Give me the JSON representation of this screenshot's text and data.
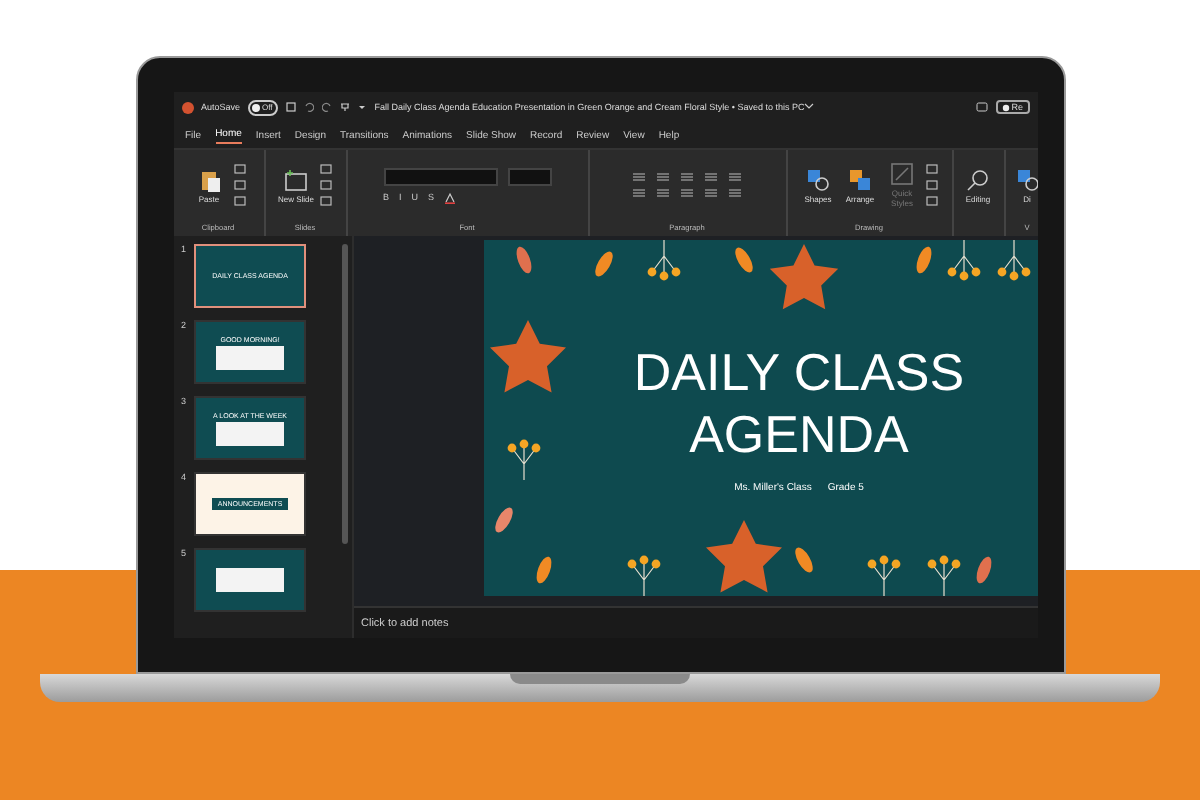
{
  "titlebar": {
    "autosave_label": "AutoSave",
    "autosave": {
      "on": false,
      "label": "Off"
    },
    "title": "Fall Daily Class Agenda Education Presentation in Green Orange and Cream Floral Style • Saved to this PC",
    "record_button": "Re"
  },
  "tabs": [
    {
      "label": "File",
      "selected": false
    },
    {
      "label": "Home",
      "selected": true
    },
    {
      "label": "Insert",
      "selected": false
    },
    {
      "label": "Design",
      "selected": false
    },
    {
      "label": "Transitions",
      "selected": false
    },
    {
      "label": "Animations",
      "selected": false
    },
    {
      "label": "Slide Show",
      "selected": false
    },
    {
      "label": "Record",
      "selected": false
    },
    {
      "label": "Review",
      "selected": false
    },
    {
      "label": "View",
      "selected": false
    },
    {
      "label": "Help",
      "selected": false
    }
  ],
  "ribbon": {
    "groups": [
      {
        "kind": "clipboard",
        "label": "Clipboard",
        "buttons": [
          {
            "label": "Paste",
            "disabled": false
          }
        ]
      },
      {
        "kind": "slides",
        "label": "Slides",
        "buttons": [
          {
            "label": "New Slide",
            "disabled": false
          }
        ]
      },
      {
        "kind": "font",
        "label": "Font",
        "format_buttons": [
          "B",
          "I",
          "U",
          "S"
        ]
      },
      {
        "kind": "paragraph",
        "label": "Paragraph"
      },
      {
        "kind": "drawing",
        "label": "Drawing",
        "buttons": [
          {
            "label": "Shapes",
            "disabled": false
          },
          {
            "label": "Arrange",
            "disabled": false
          },
          {
            "label": "Quick Styles",
            "disabled": true
          }
        ]
      },
      {
        "kind": "editing",
        "buttons": [
          {
            "label": "Editing",
            "disabled": false
          }
        ]
      },
      {
        "kind": "cut",
        "label": "V",
        "buttons": [
          {
            "label": "Di",
            "disabled": false
          }
        ]
      }
    ]
  },
  "thumbnails": [
    {
      "number": "1",
      "kind": "title",
      "title": "DAILY CLASS AGENDA",
      "selected": true
    },
    {
      "number": "2",
      "kind": "list",
      "title": "GOOD MORNING!",
      "selected": false
    },
    {
      "number": "3",
      "kind": "table",
      "title": "A LOOK AT THE WEEK",
      "selected": false
    },
    {
      "number": "4",
      "kind": "cream",
      "title": "ANNOUNCEMENTS",
      "selected": false
    },
    {
      "number": "5",
      "kind": "grid",
      "selected": false
    }
  ],
  "slide": {
    "title": "DAILY CLASS AGENDA",
    "subtitle": [
      "Ms. Miller's Class",
      "Grade 5"
    ]
  },
  "notes": {
    "placeholder": "Click to add notes"
  }
}
